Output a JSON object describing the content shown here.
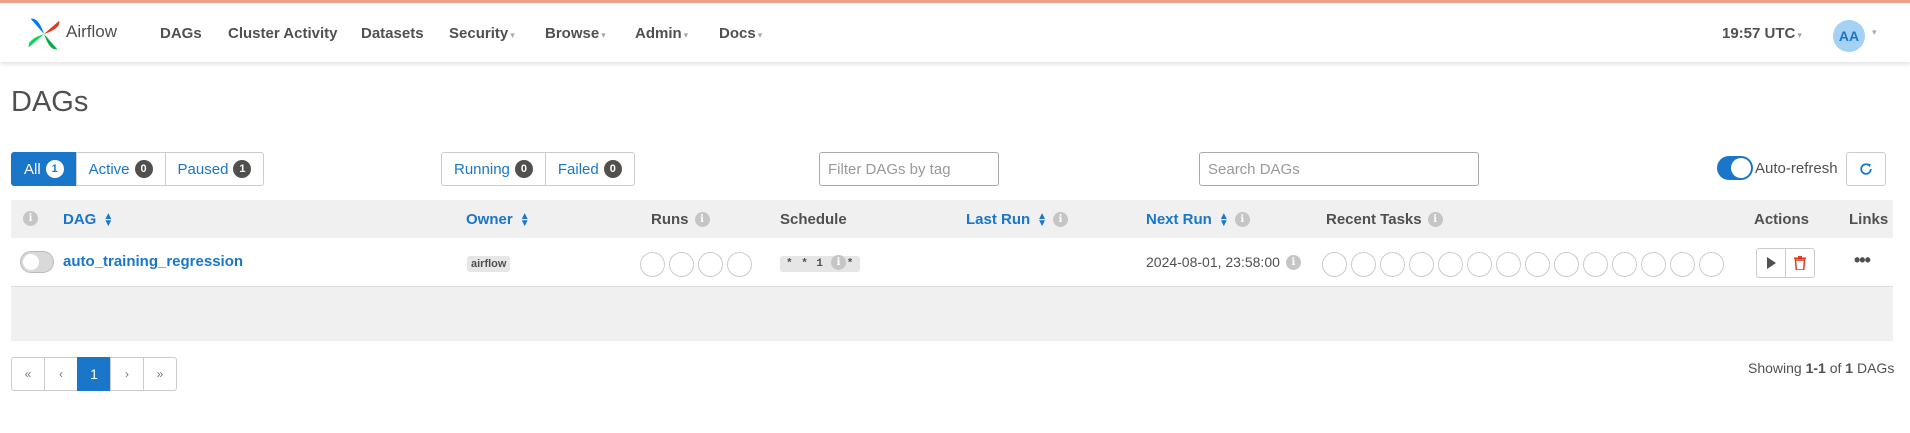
{
  "app": {
    "brand": "Airflow"
  },
  "nav": {
    "items": [
      {
        "label": "DAGs",
        "dropdown": false
      },
      {
        "label": "Cluster Activity",
        "dropdown": false
      },
      {
        "label": "Datasets",
        "dropdown": false
      },
      {
        "label": "Security",
        "dropdown": true
      },
      {
        "label": "Browse",
        "dropdown": true
      },
      {
        "label": "Admin",
        "dropdown": true
      },
      {
        "label": "Docs",
        "dropdown": true
      }
    ],
    "clock": "19:57 UTC",
    "user_initials": "AA"
  },
  "page": {
    "title": "DAGs"
  },
  "filters": {
    "status": [
      {
        "label": "All",
        "count": "1",
        "active": true
      },
      {
        "label": "Active",
        "count": "0",
        "active": false
      },
      {
        "label": "Paused",
        "count": "1",
        "active": false
      }
    ],
    "run_state": [
      {
        "label": "Running",
        "count": "0"
      },
      {
        "label": "Failed",
        "count": "0"
      }
    ],
    "tag_placeholder": "Filter DAGs by tag",
    "search_placeholder": "Search DAGs",
    "auto_refresh_label": "Auto-refresh",
    "auto_refresh_on": true
  },
  "table": {
    "headers": {
      "dag": "DAG",
      "owner": "Owner",
      "runs": "Runs",
      "schedule": "Schedule",
      "last_run": "Last Run",
      "next_run": "Next Run",
      "recent_tasks": "Recent Tasks",
      "actions": "Actions",
      "links": "Links"
    },
    "rows": [
      {
        "dag_id": "auto_training_regression",
        "paused": true,
        "owner": "airflow",
        "schedule": "* * 1 * *",
        "last_run": "",
        "next_run": "2024-08-01, 23:58:00",
        "run_circles": 4,
        "task_circles": 14
      }
    ]
  },
  "pagination": {
    "first": "«",
    "prev": "‹",
    "current": "1",
    "next": "›",
    "last": "»"
  },
  "showing": {
    "prefix": "Showing",
    "range": "1-1",
    "of": "of",
    "total": "1",
    "suffix": "DAGs"
  },
  "colors": {
    "accent": "#1a76c8",
    "top_border": "#f0a08a",
    "delete": "#e43921"
  },
  "icons": [
    "airflow-logo-icon",
    "info-icon",
    "sort-icon",
    "refresh-icon",
    "play-icon",
    "trash-icon",
    "more-icon"
  ]
}
